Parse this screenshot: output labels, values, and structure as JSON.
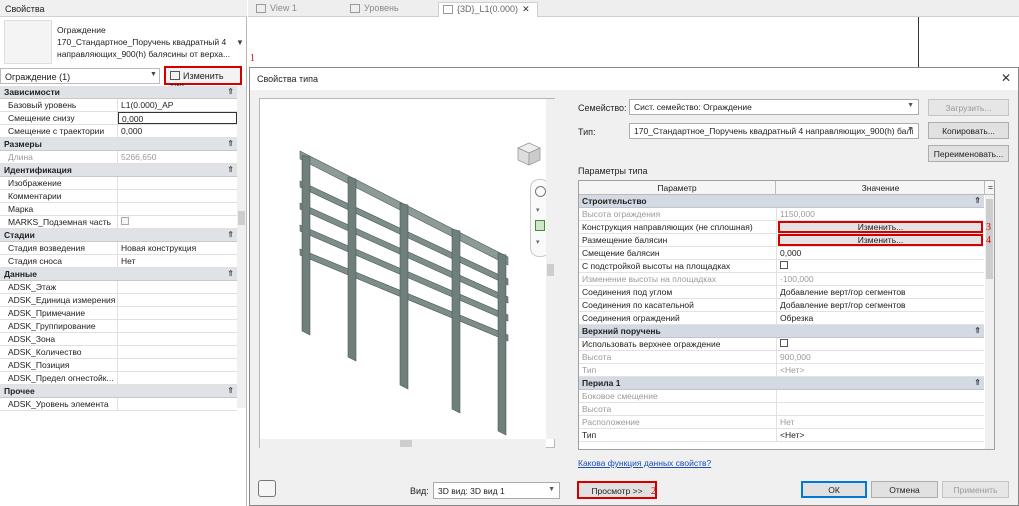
{
  "properties_panel": {
    "title": "Свойства",
    "type_name_lines": [
      "Ограждение",
      "170_Стандартное_Поручень квадратный 4",
      "направляющих_900(h) балясины от верха..."
    ],
    "instance_filter": "Ограждение (1)",
    "edit_type_label": "Изменить тип",
    "sections": [
      {
        "title": "Зависимости",
        "rows": [
          {
            "name": "Базовый уровень",
            "value": "L1(0.000)_AP"
          },
          {
            "name": "Смещение снизу",
            "value": "0,000"
          },
          {
            "name": "Смещение с траектории",
            "value": "0,000"
          }
        ]
      },
      {
        "title": "Размеры",
        "rows": [
          {
            "name": "Длина",
            "value": "5266,650"
          }
        ]
      },
      {
        "title": "Идентификация",
        "rows": [
          {
            "name": "Изображение",
            "value": ""
          },
          {
            "name": "Комментарии",
            "value": ""
          },
          {
            "name": "Марка",
            "value": ""
          },
          {
            "name": "MARKS_Подземная часть",
            "value": ""
          }
        ]
      },
      {
        "title": "Стадии",
        "rows": [
          {
            "name": "Стадия возведения",
            "value": "Новая конструкция"
          },
          {
            "name": "Стадия сноса",
            "value": "Нет"
          }
        ]
      },
      {
        "title": "Данные",
        "rows": [
          {
            "name": "ADSK_Этаж",
            "value": ""
          },
          {
            "name": "ADSK_Единица измерения",
            "value": ""
          },
          {
            "name": "ADSK_Примечание",
            "value": ""
          },
          {
            "name": "ADSK_Группирование",
            "value": ""
          },
          {
            "name": "ADSK_Зона",
            "value": ""
          },
          {
            "name": "ADSK_Количество",
            "value": ""
          },
          {
            "name": "ADSK_Позиция",
            "value": ""
          },
          {
            "name": "ADSK_Предел огнестойк...",
            "value": ""
          }
        ]
      },
      {
        "title": "Прочее",
        "rows": [
          {
            "name": "ADSK_Уровень элемента",
            "value": ""
          }
        ]
      }
    ]
  },
  "view_tabs": [
    {
      "label": "View 1",
      "active": false
    },
    {
      "label": "Уровень",
      "active": false
    },
    {
      "label": "{3D}_L1(0.000)",
      "active": true
    }
  ],
  "dialog": {
    "title": "Свойства типа",
    "close_glyph": "✕",
    "family_label": "Семейство:",
    "family_value": "Сист. семейство: Ограждение",
    "type_label": "Тип:",
    "type_value": "170_Стандартное_Поручень квадратный 4 направляющих_900(h) балі",
    "load_button": "Загрузить...",
    "copy_button": "Копировать...",
    "rename_button": "Переименовать...",
    "type_params_label": "Параметры типа",
    "col_param": "Параметр",
    "col_value": "Значение",
    "col_eq": "=",
    "sections": [
      {
        "title": "Строительство",
        "rows": [
          {
            "name": "Высота ограждения",
            "value": "1150,000",
            "disabled": true
          },
          {
            "name": "Конструкция направляющих (не сплошная)",
            "value": "Изменить...",
            "button": true
          },
          {
            "name": "Размещение балясин",
            "value": "Изменить...",
            "button": true
          },
          {
            "name": "Смещение балясин",
            "value": "0,000"
          },
          {
            "name": "С подстройкой высоты на площадках",
            "value": "",
            "checkbox": true
          },
          {
            "name": "Изменение высоты на площадках",
            "value": "-100,000",
            "disabled": true
          },
          {
            "name": "Соединения под углом",
            "value": "Добавление верт/гор сегментов"
          },
          {
            "name": "Соединения по касательной",
            "value": "Добавление верт/гор сегментов"
          },
          {
            "name": "Соединения ограждений",
            "value": "Обрезка"
          }
        ]
      },
      {
        "title": "Верхний поручень",
        "rows": [
          {
            "name": "Использовать верхнее ограждение",
            "value": "",
            "checkbox": true
          },
          {
            "name": "Высота",
            "value": "900,000",
            "disabled": true
          },
          {
            "name": "Тип",
            "value": "<Нет>",
            "disabled": true
          }
        ]
      },
      {
        "title": "Перила 1",
        "rows": [
          {
            "name": "Боковое смещение",
            "value": "",
            "disabled": true
          },
          {
            "name": "Высота",
            "value": "",
            "disabled": true
          },
          {
            "name": "Расположение",
            "value": "Нет",
            "disabled": true
          },
          {
            "name": "Тип",
            "value": "<Нет>"
          }
        ]
      }
    ],
    "help_link": "Какова функция данных свойств?",
    "view_label": "Вид:",
    "view_value": "3D вид: 3D вид 1",
    "preview_button": "Просмотр >>",
    "ok_button": "ОК",
    "cancel_button": "Отмена",
    "apply_button": "Применить"
  },
  "annotations": [
    "1",
    "2",
    "3",
    "4"
  ],
  "colors": {
    "highlight": "#d40000",
    "section_bg": "#d4dae3",
    "railing": "#6f7f7c"
  }
}
